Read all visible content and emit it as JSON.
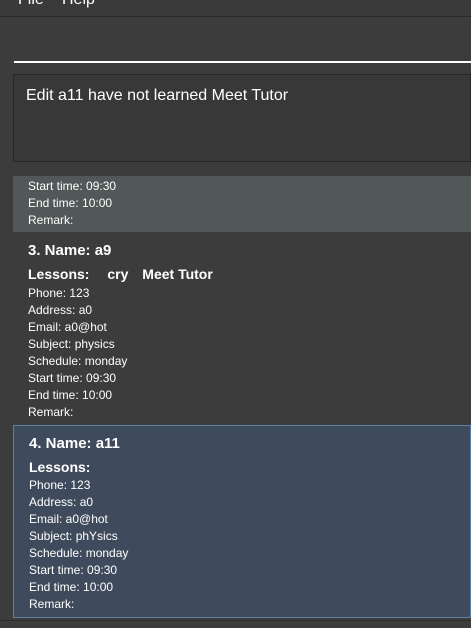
{
  "menu": {
    "file": "File",
    "help": "Help"
  },
  "command": {
    "value": "",
    "placeholder": ""
  },
  "result": {
    "text": "Edit a11 have not learned Meet Tutor"
  },
  "partial_card": {
    "start": "Start time: 09:30",
    "end": "End time: 10:00",
    "remark": "Remark:"
  },
  "cards": [
    {
      "title": "3.  Name: a9",
      "lessons_label": "Lessons:",
      "tags": [
        "cry",
        "Meet Tutor"
      ],
      "phone": "Phone: 123",
      "address": "Address: a0",
      "email": "Email: a0@hot",
      "subject": "Subject: physics",
      "schedule": "Schedule: monday",
      "start": "Start time: 09:30",
      "end": "End time: 10:00",
      "remark": "Remark:"
    },
    {
      "title": "4.  Name: a11",
      "lessons_label": "Lessons:",
      "phone": "Phone: 123",
      "address": "Address: a0",
      "email": "Email: a0@hot",
      "subject": "Subject: phYsics",
      "schedule": "Schedule: monday",
      "start": "Start time: 09:30",
      "end": "End time: 10:00",
      "remark": "Remark:"
    }
  ]
}
